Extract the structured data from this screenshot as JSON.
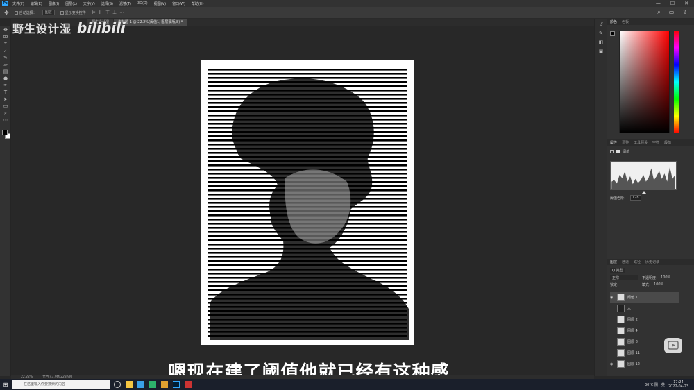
{
  "menu": {
    "logo": "Ps",
    "items": [
      "文件(F)",
      "编辑(E)",
      "图像(I)",
      "图层(L)",
      "文字(Y)",
      "选择(S)",
      "滤镜(T)",
      "3D(D)",
      "视图(V)",
      "窗口(W)",
      "帮助(H)"
    ],
    "window_buttons": [
      "—",
      "☐",
      "✕"
    ]
  },
  "options": {
    "auto_select": "自动选择：",
    "layer_select": "图层",
    "show_transform": "显示变换控件"
  },
  "tabs": [
    {
      "label": "野生设计湿",
      "active": false
    },
    {
      "label": "未标题-1 @ 22.2%(阈值1, 图层蒙版/8) *",
      "active": true
    }
  ],
  "watermark": {
    "text": "野生设计湿",
    "logo": "bilibili"
  },
  "caption": "嗯现在建了阈值他就已经有这种感",
  "status": {
    "zoom": "22.22%",
    "doc": "文档:43.9M/223.9M"
  },
  "panels": {
    "color_tabs": [
      "颜色",
      "色板"
    ],
    "props_tabs": [
      "属性",
      "调整",
      "工具预设",
      "字符",
      "段落"
    ],
    "props_title": "阈值",
    "threshold_label": "阈值色阶：",
    "threshold_value": "128",
    "layers_tabs": [
      "图层",
      "通道",
      "路径",
      "历史记录"
    ],
    "layers_kind": "Q 类型",
    "blend_mode": "正常",
    "opacity_label": "不透明度：",
    "opacity_value": "100%",
    "lock_label": "锁定：",
    "fill_label": "填充：",
    "fill_value": "100%",
    "layers": [
      {
        "name": "阈值 1",
        "active": true
      },
      {
        "name": "人",
        "active": false
      },
      {
        "name": "图层 2",
        "active": false
      },
      {
        "name": "图层 4",
        "active": false
      },
      {
        "name": "图层 8",
        "active": false
      },
      {
        "name": "图层 11",
        "active": false
      },
      {
        "name": "图层 12",
        "active": false
      }
    ]
  },
  "taskbar": {
    "search_placeholder": "在这里输入你要搜索的内容",
    "weather": "30°C 阴",
    "time": "17:24",
    "date": "2022-04-23",
    "lang": "英"
  },
  "colors": {
    "ps_blue": "#31a8ff",
    "panel_bg": "#323232",
    "canvas_bg": "#282828"
  }
}
